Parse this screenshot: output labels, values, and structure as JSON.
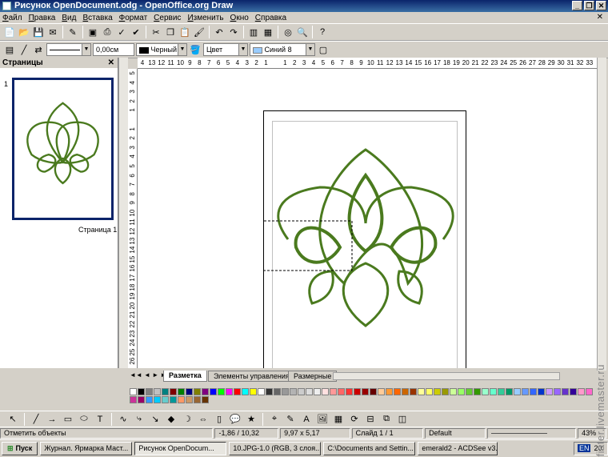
{
  "window": {
    "title": "Рисунок OpenDocument.odg - OpenOffice.org Draw",
    "buttons": [
      "_",
      "❐",
      "✕"
    ]
  },
  "menu": [
    "Файл",
    "Правка",
    "Вид",
    "Вставка",
    "Формат",
    "Сервис",
    "Изменить",
    "Окно",
    "Справка"
  ],
  "line_toolbar": {
    "line_width": "0,00см",
    "line_color": "Черный",
    "area_style": "Цвет",
    "area_color": "Синий 8"
  },
  "pages_panel": {
    "title": "Страницы",
    "close": "✕",
    "page_number": "1",
    "page_label": "Страница 1"
  },
  "rulers": {
    "h_ticks": [
      "4",
      "13",
      "12",
      "11",
      "10",
      "9",
      "8",
      "7",
      "6",
      "5",
      "4",
      "3",
      "2",
      "1",
      "",
      "1",
      "2",
      "3",
      "4",
      "5",
      "6",
      "7",
      "8",
      "9",
      "10",
      "11",
      "12",
      "13",
      "14",
      "15",
      "16",
      "17",
      "18",
      "19",
      "20",
      "21",
      "22",
      "23",
      "24",
      "25",
      "26",
      "27",
      "28",
      "29",
      "30",
      "31",
      "32",
      "33"
    ],
    "v_ticks": [
      "5",
      "4",
      "3",
      "2",
      "1",
      "",
      "1",
      "2",
      "3",
      "4",
      "5",
      "6",
      "7",
      "8",
      "9",
      "10",
      "11",
      "12",
      "13",
      "14",
      "15",
      "16",
      "17",
      "18",
      "19",
      "20",
      "21",
      "22",
      "23",
      "24",
      "25",
      "26"
    ]
  },
  "tabs": [
    "Разметка",
    "Элементы управления",
    "Размерные"
  ],
  "palette": [
    "#ffffff",
    "#000000",
    "#808080",
    "#c0c0c0",
    "#008080",
    "#800000",
    "#008000",
    "#000080",
    "#808000",
    "#800080",
    "#0000ff",
    "#00ff00",
    "#ff00ff",
    "#ff0000",
    "#00ffff",
    "#ffff00",
    "#ffffff",
    "#333333",
    "#666666",
    "#999999",
    "#b3b3b3",
    "#cccccc",
    "#dddddd",
    "#eeeeee",
    "#ffe0e0",
    "#ff9999",
    "#ff6666",
    "#ff3333",
    "#cc0000",
    "#990000",
    "#660000",
    "#ffcc99",
    "#ff9933",
    "#ff6600",
    "#cc6600",
    "#993300",
    "#ffff99",
    "#ffff66",
    "#cccc00",
    "#999900",
    "#ccff99",
    "#99ff66",
    "#66cc33",
    "#339900",
    "#99ffcc",
    "#66ffcc",
    "#33cc99",
    "#009966",
    "#99ccff",
    "#6699ff",
    "#3366ff",
    "#0033cc",
    "#cc99ff",
    "#9966ff",
    "#6633cc",
    "#330099",
    "#ff99cc",
    "#ff66cc",
    "#cc3399",
    "#990066",
    "#3399ff",
    "#00ccff",
    "#66cccc",
    "#009999",
    "#ff9966",
    "#cc9966",
    "#996633",
    "#663300"
  ],
  "status": {
    "action": "Отметить объекты",
    "position": "-1,86 / 10,32",
    "size": "9,97 x 5,17",
    "slide": "Слайд 1 / 1",
    "layout": "Default",
    "zoom": "43%"
  },
  "taskbar": {
    "start": "Пуск",
    "tasks": [
      "Журнал. Ярмарка Маст...",
      "Рисунок OpenDocum...",
      "10.JPG-1.0 (RGB, 3 слоя...",
      "C:\\Documents and Settin...",
      "emerald2 - ACDSee v3.1"
    ],
    "lang": "EN",
    "time": "20:"
  },
  "watermark": "fiater.livemaster.ru",
  "colors": {
    "flower": "#4a7a1e"
  }
}
